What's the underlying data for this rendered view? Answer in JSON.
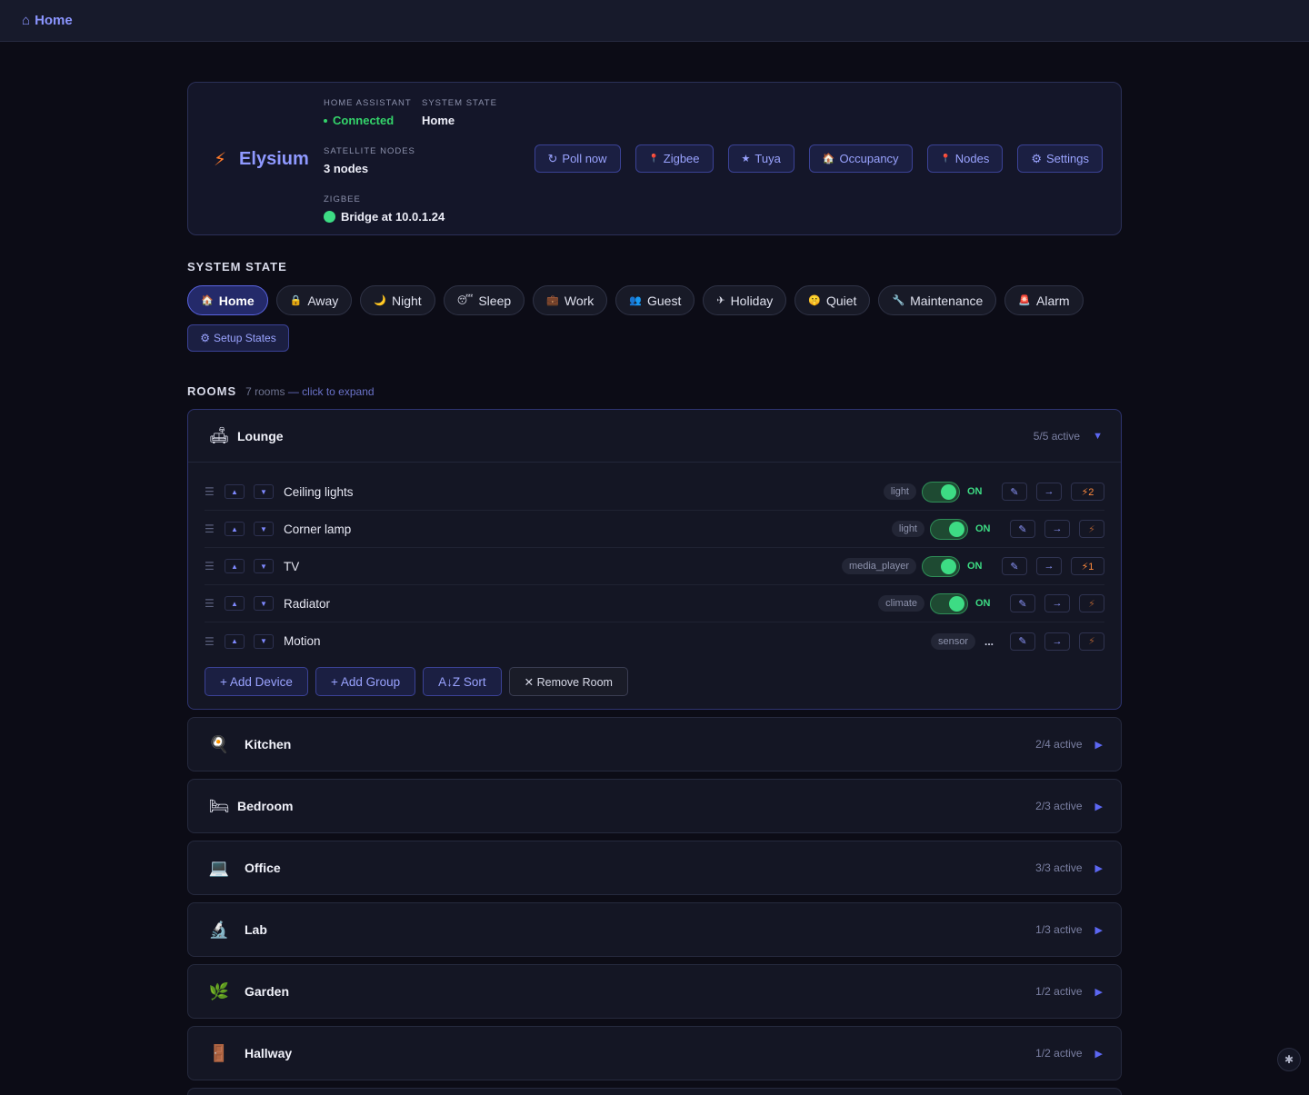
{
  "nav": {
    "home_icon": "⌂",
    "home_label": "Home"
  },
  "hero": {
    "brand_icon": "⚡",
    "brand_name": "Elysium",
    "ha_label": "HOME ASSISTANT",
    "ha_value": "Connected",
    "state_label": "SYSTEM STATE",
    "state_value": "Home",
    "nodes_label": "SATELLITE NODES",
    "nodes_value": "3 nodes",
    "zigbee_label": "ZIGBEE",
    "zigbee_value": "Bridge at 10.0.1.24",
    "actions": [
      {
        "icon": "↻",
        "label": "Poll now"
      },
      {
        "icon": "📍",
        "label": "Zigbee"
      },
      {
        "icon": "★",
        "label": "Tuya"
      },
      {
        "icon": "🏠",
        "label": "Occupancy"
      },
      {
        "icon": "📍",
        "label": "Nodes"
      },
      {
        "icon": "⚙",
        "label": "Settings"
      }
    ]
  },
  "states": {
    "title": "SYSTEM STATE",
    "items": [
      {
        "icon": "🏠",
        "label": "Home",
        "active": true
      },
      {
        "icon": "🔒",
        "label": "Away"
      },
      {
        "icon": "🌙",
        "label": "Night"
      },
      {
        "icon": "😴",
        "label": "Sleep"
      },
      {
        "icon": "💼",
        "label": "Work"
      },
      {
        "icon": "👥",
        "label": "Guest"
      },
      {
        "icon": "✈",
        "label": "Holiday"
      },
      {
        "icon": "🤫",
        "label": "Quiet"
      },
      {
        "icon": "🔧",
        "label": "Maintenance"
      },
      {
        "icon": "🚨",
        "label": "Alarm"
      }
    ],
    "setup_icon": "⚙",
    "setup_label": "Setup States"
  },
  "rooms": {
    "title": "ROOMS",
    "count": "7 rooms",
    "hint": "— click to expand",
    "open_room": {
      "icon": "🛋",
      "name": "Lounge",
      "active": "5/5 active",
      "devices": [
        {
          "name": "Ceiling lights",
          "type": "light",
          "state": "ON",
          "bolt": "⚡2"
        },
        {
          "name": "Corner lamp",
          "type": "light",
          "state": "ON",
          "bolt": "⚡"
        },
        {
          "name": "TV",
          "type": "media_player",
          "state": "ON",
          "bolt": "⚡1"
        },
        {
          "name": "Radiator",
          "type": "climate",
          "state": "ON",
          "bolt": "⚡"
        },
        {
          "name": "Motion",
          "type": "sensor",
          "state": "...",
          "bolt": "⚡"
        }
      ],
      "actions": {
        "add_device": "+ Add Device",
        "add_group": "+ Add Group",
        "sort": "A↓Z Sort",
        "remove": "✕ Remove Room"
      }
    },
    "list": [
      {
        "icon": "🍳",
        "name": "Kitchen",
        "active": "2/4 active"
      },
      {
        "icon": "🛏",
        "name": "Bedroom",
        "active": "2/3 active"
      },
      {
        "icon": "💻",
        "name": "Office",
        "active": "3/3 active"
      },
      {
        "icon": "🔬",
        "name": "Lab",
        "active": "1/3 active"
      },
      {
        "icon": "🌿",
        "name": "Garden",
        "active": "1/2 active"
      },
      {
        "icon": "🚪",
        "name": "Hallway",
        "active": "1/2 active"
      }
    ]
  },
  "fab_icon": "✱",
  "colors": {
    "accent": "#8b95ff",
    "on": "#3ddc84",
    "bg": "#0c0c16",
    "card": "#141624"
  }
}
